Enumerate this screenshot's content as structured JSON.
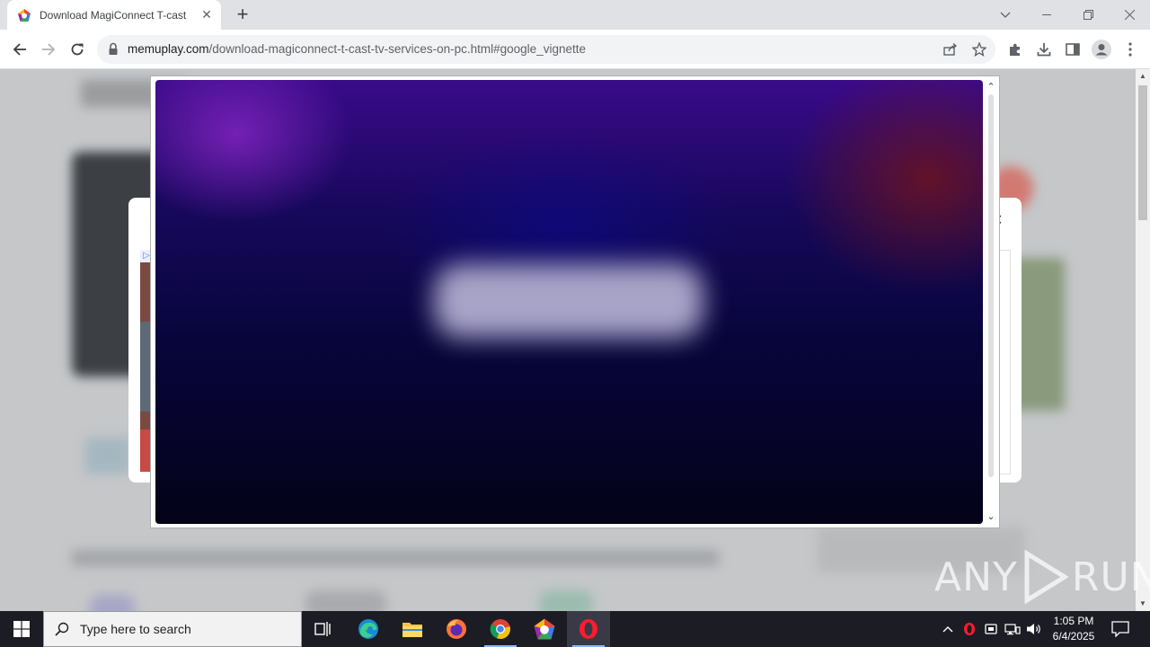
{
  "browser": {
    "tab": {
      "title": "Download MagiConnect T-cast T",
      "close_glyph": "✕",
      "favicon": "memuplay-icon"
    },
    "new_tab_glyph": "+",
    "window_controls": {
      "tab_search": "chevron-down-icon",
      "minimize": "minimize-icon",
      "restore": "restore-icon",
      "close": "close-icon"
    },
    "address_bar": {
      "host": "memuplay.com",
      "path": "/download-magiconnect-t-cast-tv-services-on-pc.html#google_vignette"
    }
  },
  "page": {
    "overlay_type": "google_vignette ad",
    "accent_colors": {
      "ad_top": "#3a0a8a",
      "ad_bottom": "#040318",
      "ad_button": "#a8a4c8"
    }
  },
  "watermark": {
    "left_text": "ANY",
    "right_text": "RUN"
  },
  "taskbar": {
    "search_placeholder": "Type here to search",
    "apps": [
      "task-view-icon",
      "edge-icon",
      "file-explorer-icon",
      "firefox-icon",
      "chrome-icon",
      "memuplay-icon",
      "opera-icon"
    ],
    "tray": [
      "show-hidden-icons",
      "opera-tray-icon",
      "device-icon",
      "network-icon",
      "volume-icon"
    ],
    "clock": {
      "time": "1:05 PM",
      "date": "6/4/2025"
    }
  }
}
